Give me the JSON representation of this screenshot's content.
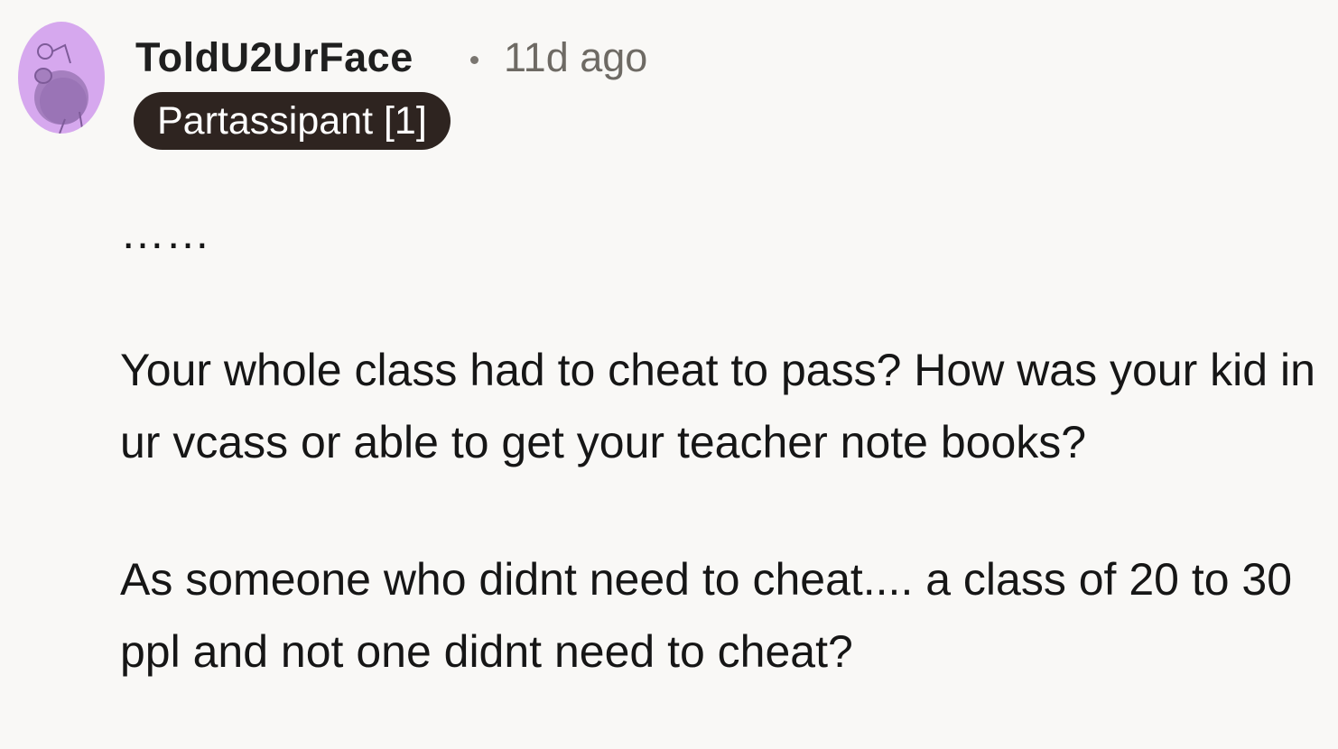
{
  "comment": {
    "author": {
      "username": "ToldU2UrFace",
      "avatar_icon": "snoo-avatar-icon",
      "avatar_color": "#d6a8ee"
    },
    "separator": "•",
    "timestamp": "11d ago",
    "flair": {
      "label": "Partassipant [1]",
      "background": "#2e2420"
    },
    "paragraphs": [
      "……",
      "Your whole class had to cheat to pass? How was your kid in ur vcass or able to get your teacher note books?",
      "As someone who didnt need to cheat.... a class of 20 to 30 ppl and not one didnt need to cheat?"
    ]
  }
}
